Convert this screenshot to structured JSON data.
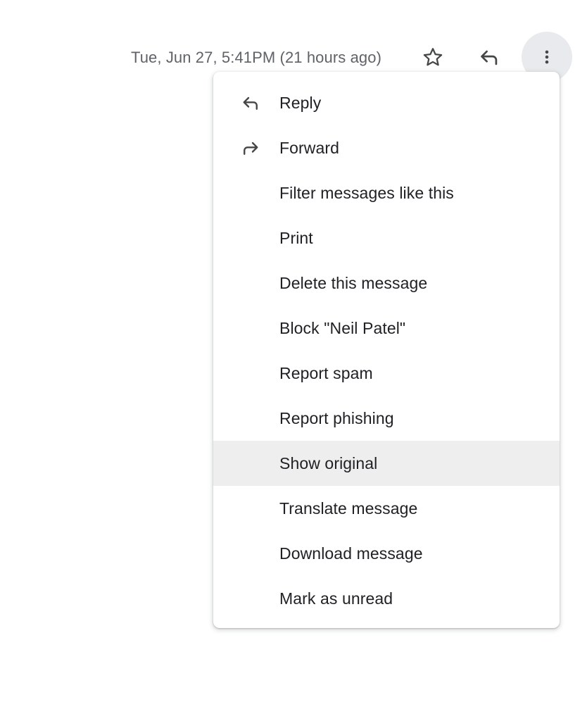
{
  "colors": {
    "page_background": "#ffffff",
    "menu_background": "#ffffff",
    "menu_item_text": "#202124",
    "menu_item_highlight": "#eeeeee",
    "timestamp_text": "#5f6368",
    "icon": "#444746",
    "more_button_background": "#e8eaed"
  },
  "header": {
    "timestamp": "Tue, Jun 27, 5:41PM (21 hours ago)",
    "actions": [
      {
        "name": "star-icon",
        "label": "Not starred"
      },
      {
        "name": "reply-icon",
        "label": "Reply"
      },
      {
        "name": "more-icon",
        "label": "More"
      }
    ]
  },
  "menu": {
    "items": [
      {
        "label": "Reply",
        "icon": "reply-icon",
        "highlighted": false
      },
      {
        "label": "Forward",
        "icon": "forward-icon",
        "highlighted": false
      },
      {
        "label": "Filter messages like this",
        "icon": null,
        "highlighted": false
      },
      {
        "label": "Print",
        "icon": null,
        "highlighted": false
      },
      {
        "label": "Delete this message",
        "icon": null,
        "highlighted": false
      },
      {
        "label": "Block \"Neil Patel\"",
        "icon": null,
        "highlighted": false
      },
      {
        "label": "Report spam",
        "icon": null,
        "highlighted": false
      },
      {
        "label": "Report phishing",
        "icon": null,
        "highlighted": false
      },
      {
        "label": "Show original",
        "icon": null,
        "highlighted": true
      },
      {
        "label": "Translate message",
        "icon": null,
        "highlighted": false
      },
      {
        "label": "Download message",
        "icon": null,
        "highlighted": false
      },
      {
        "label": "Mark as unread",
        "icon": null,
        "highlighted": false
      }
    ]
  }
}
